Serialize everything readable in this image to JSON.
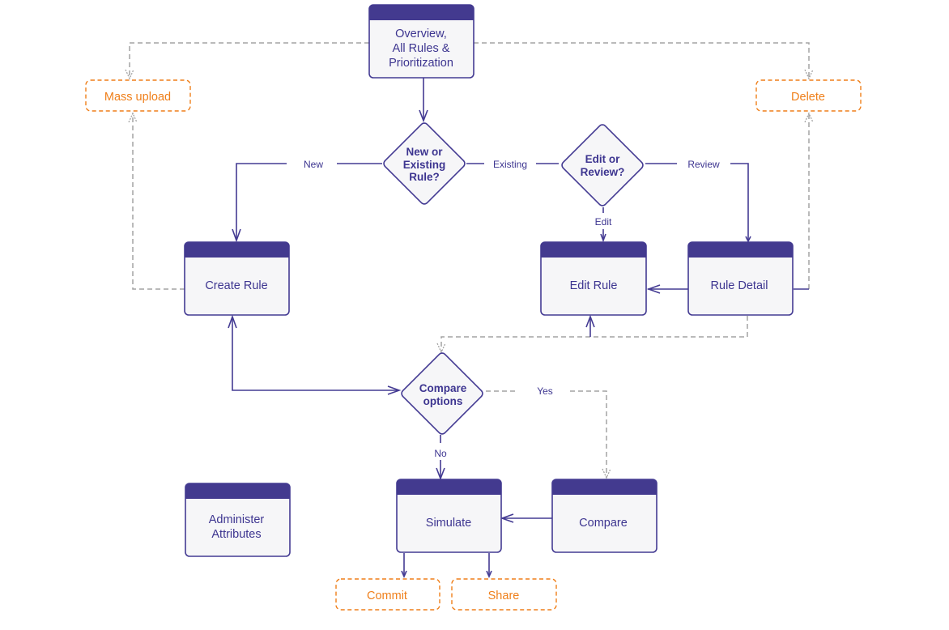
{
  "diagram": {
    "colors": {
      "primary": "#443b93",
      "header": "#433a8f",
      "node_fill": "#f6f6f8",
      "action": "#ef7f1a",
      "dashed_line": "#a3a3a3",
      "text": "#3d3590"
    },
    "nodes": {
      "overview": {
        "lines": [
          "Overview,",
          "All Rules &",
          "Prioritization"
        ]
      },
      "create_rule": {
        "lines": [
          "Create Rule"
        ]
      },
      "edit_rule": {
        "lines": [
          "Edit Rule"
        ]
      },
      "rule_detail": {
        "lines": [
          "Rule Detail"
        ]
      },
      "simulate": {
        "lines": [
          "Simulate"
        ]
      },
      "compare": {
        "lines": [
          "Compare"
        ]
      },
      "administer_attributes": {
        "lines": [
          "Administer",
          "Attributes"
        ]
      }
    },
    "decisions": {
      "new_or_existing": {
        "lines": [
          "New or",
          "Existing",
          "Rule?"
        ]
      },
      "edit_or_review": {
        "lines": [
          "Edit or",
          "Review?"
        ]
      },
      "compare_options": {
        "lines": [
          "Compare",
          "options"
        ]
      }
    },
    "actions": {
      "mass_upload": "Mass upload",
      "delete": "Delete",
      "commit": "Commit",
      "share": "Share"
    },
    "edge_labels": {
      "new": "New",
      "existing": "Existing",
      "review": "Review",
      "edit": "Edit",
      "yes": "Yes",
      "no": "No"
    }
  }
}
